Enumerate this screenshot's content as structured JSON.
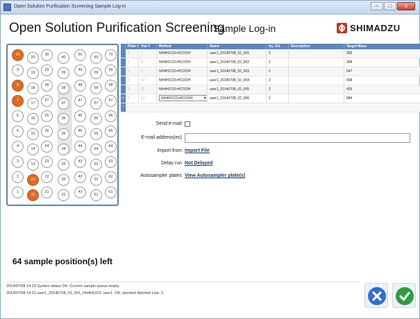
{
  "window": {
    "title": "Open Solution Purification Screening Sample Log-in",
    "buttons": [
      "–",
      "□",
      "x"
    ]
  },
  "header": {
    "title": "Open Solution Purification Screening",
    "subtitle": "Sample Log-in",
    "brand": "SHIMADZU",
    "brand_color": "#d92a1c"
  },
  "plate": {
    "selected_color": "#e06a1f",
    "columns": [
      {
        "wells": [
          "10",
          "9",
          "8",
          "7",
          "6",
          "5",
          "4",
          "3",
          "2",
          "1"
        ],
        "selected": [
          "10",
          "8",
          "7"
        ]
      },
      {
        "wells": [
          "20",
          "19",
          "18",
          "17",
          "16",
          "15",
          "14",
          "13",
          "12",
          "11"
        ],
        "selected": [
          "12",
          "11"
        ]
      },
      {
        "wells": [
          "30",
          "29",
          "28",
          "27",
          "26",
          "25",
          "24",
          "23",
          "22",
          "21"
        ],
        "selected": []
      },
      {
        "wells": [
          "40",
          "39",
          "38",
          "37",
          "36",
          "35",
          "34",
          "33",
          "32",
          "31"
        ],
        "selected": []
      },
      {
        "wells": [
          "50",
          "49",
          "48",
          "47",
          "46",
          "45",
          "44",
          "43",
          "42",
          "41"
        ],
        "selected": []
      },
      {
        "wells": [
          "60",
          "59",
          "58",
          "57",
          "56",
          "55",
          "54",
          "53",
          "52",
          "51"
        ],
        "selected": []
      },
      {
        "wells": [
          "70",
          "69",
          "68",
          "67",
          "66",
          "65",
          "64",
          "63",
          "62",
          "61"
        ],
        "selected": []
      }
    ]
  },
  "table": {
    "headers": [
      "Plate #",
      "Vial #",
      "Method",
      "Name",
      "Inj. Vol.",
      "Description",
      "Target Mass"
    ],
    "rows": [
      {
        "plate": "1",
        "vial": "7",
        "method": "NH4HCO3+HCOOH",
        "name": "user1_20140708_02_001",
        "inj": "2",
        "desc": "",
        "mass": "265"
      },
      {
        "plate": "1",
        "vial": "8",
        "method": "NH4HCO3+HCOOH",
        "name": "user1_20140708_02_002",
        "inj": "2",
        "desc": "",
        "mass": "368"
      },
      {
        "plate": "1",
        "vial": "9",
        "method": "NH4HCO3+HCOOH",
        "name": "user1_20140708_02_003",
        "inj": "2",
        "desc": "",
        "mass": "547"
      },
      {
        "plate": "1",
        "vial": "10",
        "method": "NH4HCO3+HCOOH",
        "name": "user1_20140708_02_004",
        "inj": "2",
        "desc": "",
        "mass": "658"
      },
      {
        "plate": "1",
        "vial": "11",
        "method": "NH4HCO3+HCOOH",
        "name": "user1_20140708_02_005",
        "inj": "2",
        "desc": "",
        "mass": "425"
      },
      {
        "plate": "1",
        "vial": "12",
        "method": "NH4HCO3+HCOOH",
        "name": "user1_20140708_02_006",
        "inj": "2",
        "desc": "",
        "mass": "684"
      }
    ],
    "edit_marker": "✎",
    "new_row_marker": "*"
  },
  "form": {
    "send_email_label": "Send e-mail",
    "send_email_checked": false,
    "email_label": "E-mail address(es)",
    "email_value": "",
    "import_label": "Import from",
    "import_link": "Import File",
    "delay_label": "Delay run",
    "delay_link": "Not Delayed",
    "autosampler_label": "Autosampler plates",
    "autosampler_link": "View Autosampler plate(s)"
  },
  "remaining": "64 sample position(s) left",
  "status": {
    "lines": [
      "2014/07/08 14:23 System status OK: Current sample queue empty.",
      "2014/07/08 14:21 user1_20140708_01_001_NH4HCO3: user1: OK; aborted: Aborted Line: 3"
    ]
  },
  "actions": {
    "cancel_icon": "close-icon",
    "ok_icon": "check-icon"
  }
}
